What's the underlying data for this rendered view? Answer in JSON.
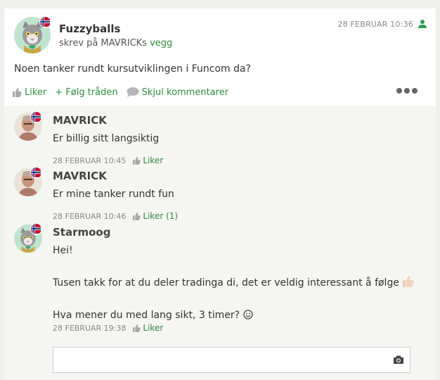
{
  "post": {
    "author": "Fuzzyballs",
    "subline_prefix": "skrev på ",
    "subline_target": "MAVRICKs",
    "subline_link": "vegg",
    "timestamp": "28 FEBRUAR 10:36",
    "body": "Noen tanker rundt kursutviklingen i Funcom da?",
    "actions": {
      "like": "Liker",
      "follow": "+ Følg tråden",
      "hide_comments": "Skjul kommentarer"
    }
  },
  "comments": [
    {
      "author": "MAVRICK",
      "text": "Er billig sitt langsiktig",
      "time": "28 FEBRUAR 10:45",
      "like": "Liker"
    },
    {
      "author": "MAVRICK",
      "text": "Er mine tanker rundt fun",
      "time": "28 FEBRUAR 10:46",
      "like": "Liker (1)"
    },
    {
      "author": "Starmoog",
      "line1": "Hei!",
      "line2": "Tusen takk for at du deler tradinga di, det er veldig interessant å følge",
      "line3": "Hva mener du med lang sikt, 3 timer?",
      "time": "28 FEBRUAR 19:38",
      "like": "Liker"
    }
  ],
  "colors": {
    "link_green": "#2e8b3e",
    "comments_bg": "#f5f5f2"
  }
}
